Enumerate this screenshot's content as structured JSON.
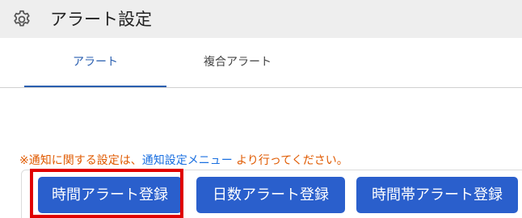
{
  "header": {
    "title": "アラート設定",
    "icon": "gear-icon"
  },
  "tabs": [
    {
      "label": "アラート",
      "active": true
    },
    {
      "label": "複合アラート",
      "active": false
    }
  ],
  "notice": {
    "prefix": "※通知に関する設定は、",
    "link": "通知設定メニュー",
    "suffix": " より行ってください。"
  },
  "buttons": {
    "time_alert": "時間アラート登録",
    "days_alert": "日数アラート登録",
    "timeslot_alert": "時間帯アラート登録"
  },
  "colors": {
    "accent": "#2a5fcc",
    "notice": "#e05a00",
    "link": "#1a6fe0",
    "highlight": "#e00000"
  }
}
